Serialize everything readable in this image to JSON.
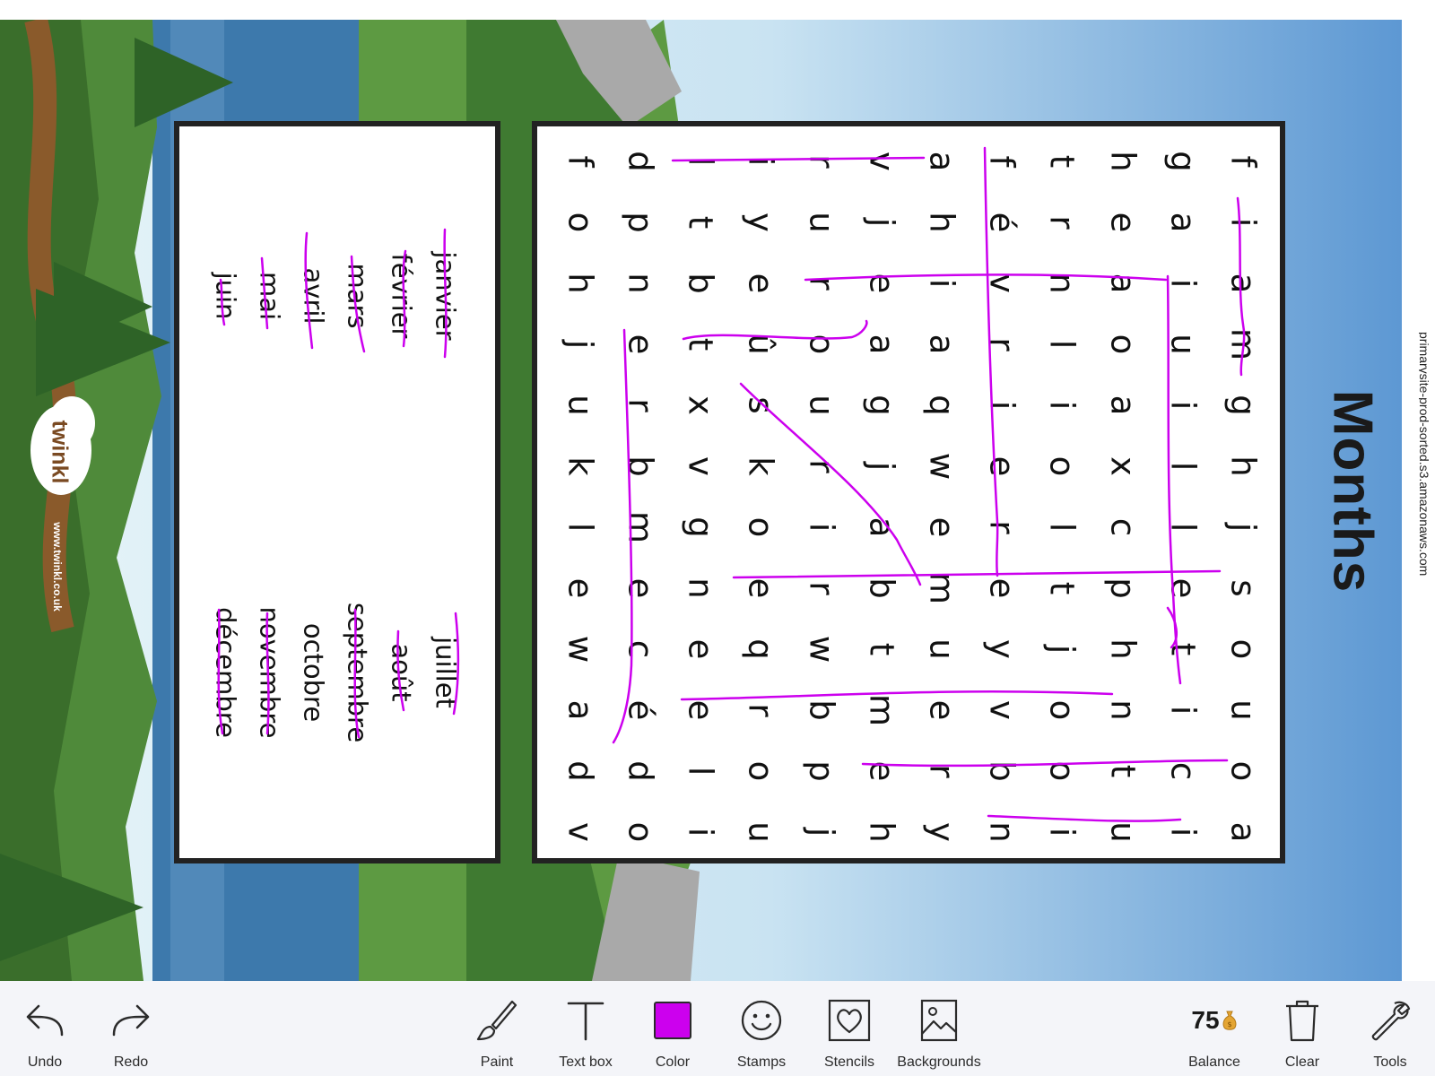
{
  "browser": {
    "url_fragment": "primarysite-prod-sorted.s3.amazonaws.com"
  },
  "worksheet": {
    "title": "Months",
    "logo": "twinkl",
    "site": "www.twinkl.co.uk",
    "grid_columns": [
      [
        "f",
        "i",
        "a",
        "m",
        "g",
        "h",
        "j",
        "s",
        "o",
        "u",
        "o",
        "a"
      ],
      [
        "g",
        "a",
        "i",
        "u",
        "i",
        "l",
        "l",
        "e",
        "t",
        "i",
        "c",
        "i"
      ],
      [
        "h",
        "e",
        "a",
        "o",
        "a",
        "x",
        "c",
        "p",
        "h",
        "n",
        "t",
        "u"
      ],
      [
        "t",
        "r",
        "n",
        "l",
        "i",
        "o",
        "l",
        "t",
        "j",
        "o",
        "o",
        "i"
      ],
      [
        "f",
        "é",
        "v",
        "r",
        "i",
        "e",
        "r",
        "e",
        "y",
        "v",
        "b",
        "n"
      ],
      [
        "a",
        "h",
        "i",
        "a",
        "q",
        "w",
        "e",
        "m",
        "u",
        "e",
        "r",
        "y"
      ],
      [
        "v",
        "j",
        "e",
        "a",
        "g",
        "j",
        "a",
        "b",
        "t",
        "m",
        "e",
        "h"
      ],
      [
        "r",
        "u",
        "r",
        "o",
        "u",
        "r",
        "i",
        "r",
        "w",
        "b",
        "p",
        "j"
      ],
      [
        "i",
        "y",
        "e",
        "û",
        "s",
        "k",
        "o",
        "e",
        "q",
        "r",
        "o",
        "u"
      ],
      [
        "l",
        "t",
        "b",
        "t",
        "x",
        "v",
        "g",
        "n",
        "e",
        "e",
        "l",
        "i"
      ],
      [
        "d",
        "p",
        "n",
        "e",
        "r",
        "b",
        "m",
        "e",
        "c",
        "é",
        "d",
        "o"
      ],
      [
        "f",
        "o",
        "h",
        "j",
        "u",
        "k",
        "l",
        "e",
        "w",
        "a",
        "d",
        "v"
      ]
    ],
    "word_list_col1": [
      "janvier",
      "février",
      "mars",
      "avril",
      "mai",
      "juin"
    ],
    "word_list_col2": [
      "juillet",
      "août",
      "septembre",
      "octobre",
      "novembre",
      "décembre"
    ]
  },
  "toolbar": {
    "undo": "Undo",
    "redo": "Redo",
    "paint": "Paint",
    "textbox": "Text box",
    "color": "Color",
    "color_value": "#cc00ee",
    "stamps": "Stamps",
    "stencils": "Stencils",
    "backgrounds": "Backgrounds",
    "balance_value": "75",
    "balance": "Balance",
    "clear": "Clear",
    "tools": "Tools"
  }
}
